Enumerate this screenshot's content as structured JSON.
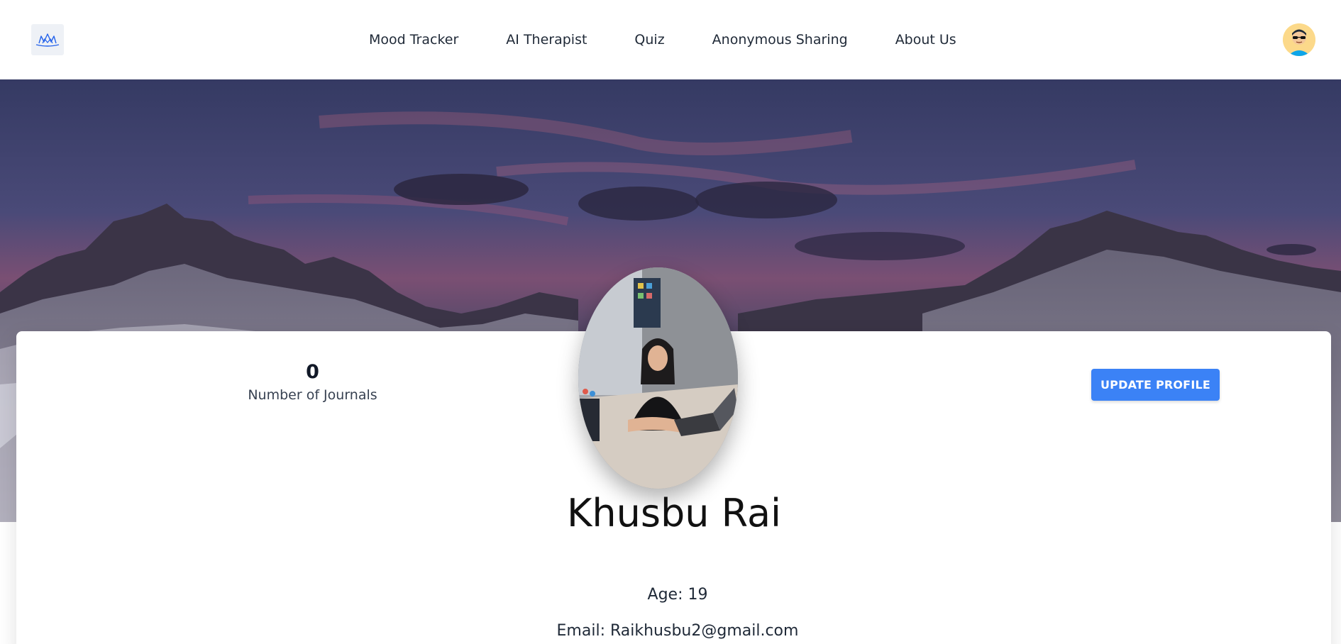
{
  "header": {
    "logo_icon": "lotus-logo-icon",
    "nav": [
      {
        "label": "Mood Tracker"
      },
      {
        "label": "AI Therapist"
      },
      {
        "label": "Quiz"
      },
      {
        "label": "Anonymous Sharing"
      },
      {
        "label": "About Us"
      }
    ],
    "avatar_icon": "user-avatar-icon"
  },
  "hero": {
    "image": "mountain-sunset-banner"
  },
  "profile": {
    "journals_count": "0",
    "journals_label": "Number of Journals",
    "update_button": "UPDATE PROFILE",
    "name": "Khusbu Rai",
    "age_line": "Age: 19",
    "email_line": "Email: Raikhusbu2@gmail.com"
  },
  "colors": {
    "accent": "#3b82f6",
    "text": "#1f2937"
  }
}
